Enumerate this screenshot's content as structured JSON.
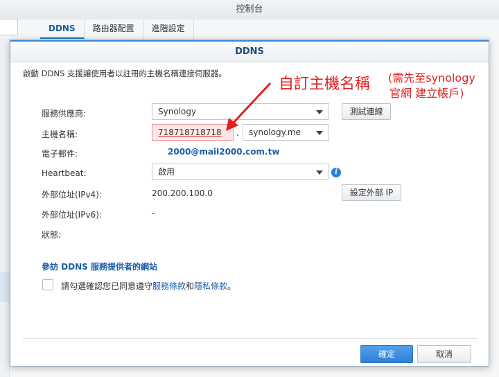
{
  "window": {
    "title": "控制台"
  },
  "tabs": [
    {
      "label": "DDNS"
    },
    {
      "label": "路由器配置"
    },
    {
      "label": "進階設定"
    }
  ],
  "dialog": {
    "title": "DDNS",
    "description": "啟動 DDNS 支援讓使用者以註冊的主機名稱連接伺服器。",
    "fields": {
      "provider_label": "服務供應商:",
      "provider_value": "Synology",
      "test_button": "測試連線",
      "hostname_label": "主機名稱:",
      "hostname_value": "718718718718",
      "hostname_separator": ".",
      "domain_value": "synology.me",
      "email_label": "電子郵件:",
      "email_value": "2000@mail2000.com.tw",
      "heartbeat_label": "Heartbeat:",
      "heartbeat_value": "啟用",
      "ipv4_label": "外部位址(IPv4):",
      "ipv4_value": "200.200.100.0",
      "set_ip_button": "設定外部 IP",
      "ipv6_label": "外部位址(IPv6):",
      "ipv6_value": "-",
      "status_label": "狀態:"
    },
    "visit_link": "參訪 DDNS 服務提供者的網站",
    "agree": {
      "prefix": "請勾選確認您已同意遵守",
      "terms_link": "服務條款",
      "and": "和",
      "privacy_link": "隱私條款",
      "suffix": "。"
    },
    "ok_button": "確定",
    "cancel_button": "取消"
  },
  "annotation": {
    "title": "自訂主機名稱",
    "note_line1": "(需先至synology",
    "note_line2": "官網 建立帳戶)",
    "color": "#e02020"
  },
  "colors": {
    "accent": "#2f80d6",
    "link": "#1c5fa8",
    "highlight": "#fde6e6"
  }
}
